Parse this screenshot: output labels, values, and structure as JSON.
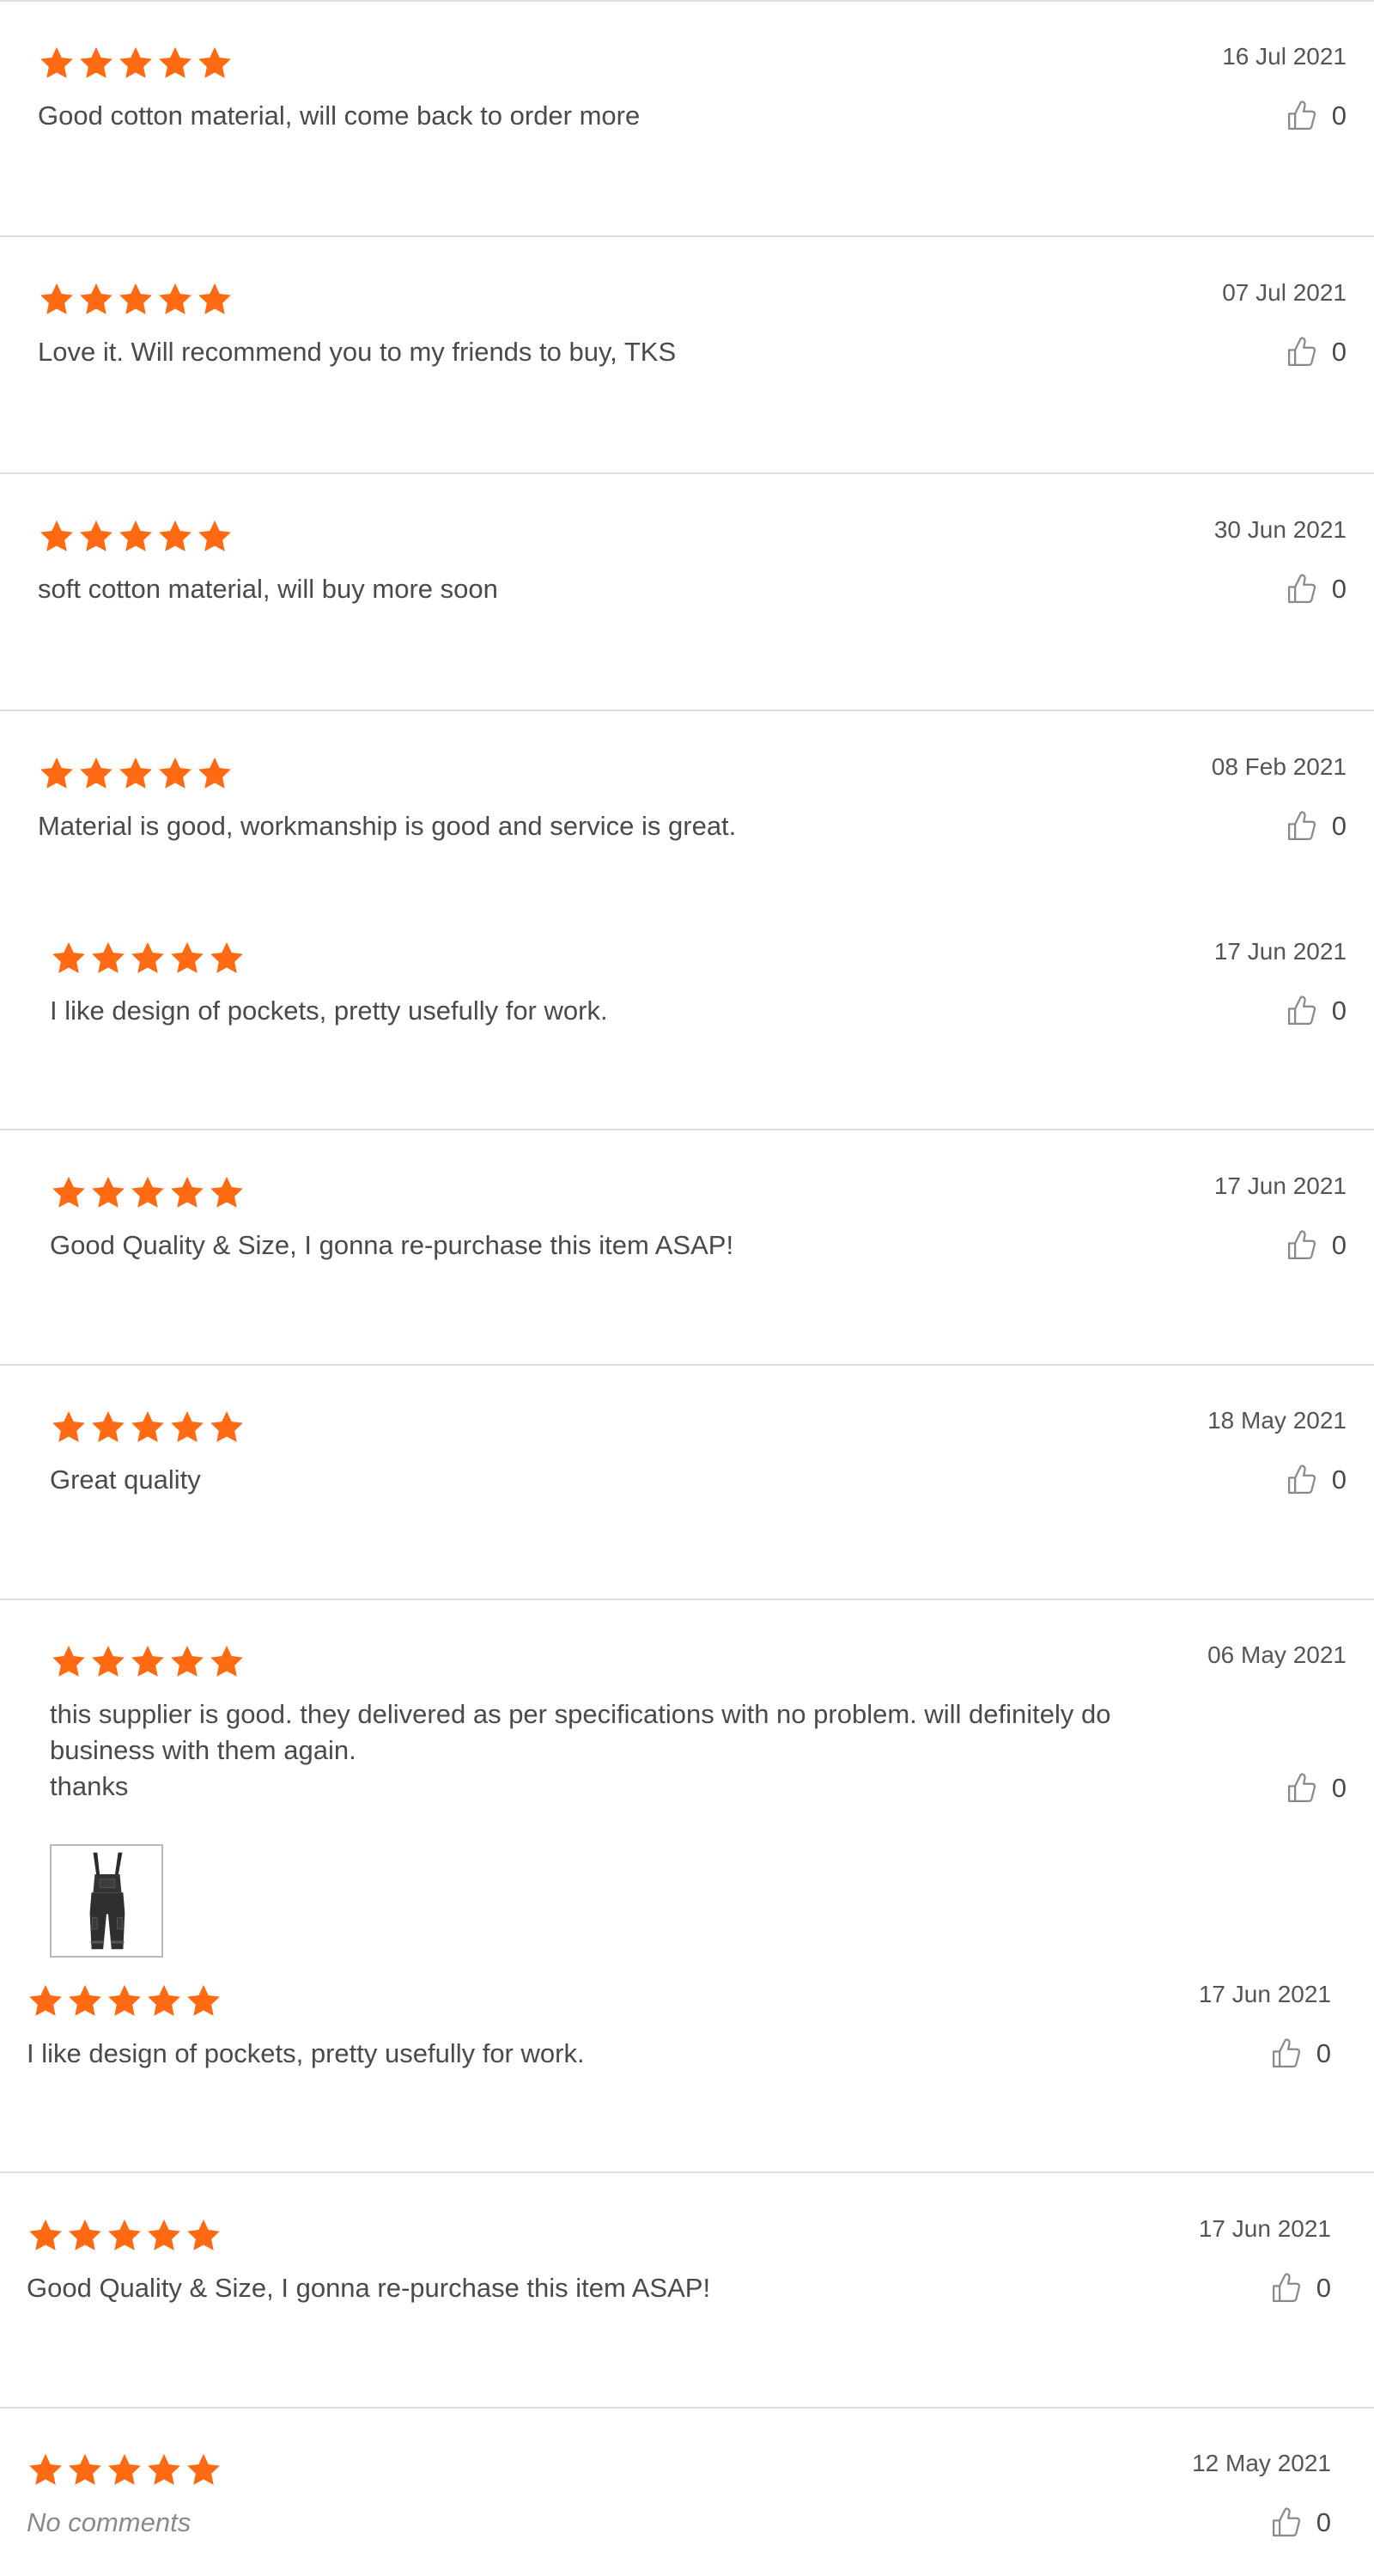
{
  "colors": {
    "star": "#FF6A13",
    "divider": "#DEDEDE",
    "text": "#4A4A4A",
    "date": "#555555"
  },
  "reviews": [
    {
      "rating": 5,
      "date": "16 Jul 2021",
      "comment": "Good cotton material, will come back to order more",
      "likes": "0"
    },
    {
      "rating": 5,
      "date": "07 Jul 2021",
      "comment": "Love it. Will recommend you to my friends to buy, TKS",
      "likes": "0"
    },
    {
      "rating": 5,
      "date": "30 Jun 2021",
      "comment": "soft cotton material, will buy more soon",
      "likes": "0"
    },
    {
      "rating": 5,
      "date": "08 Feb 2021",
      "comment": "Material is good, workmanship is good and service is great.",
      "likes": "0"
    },
    {
      "rating": 5,
      "date": "17 Jun 2021",
      "comment": "I like design of pockets, pretty usefully for work.",
      "likes": "0"
    },
    {
      "rating": 5,
      "date": "17 Jun 2021",
      "comment": "Good Quality & Size, I gonna re-purchase this item ASAP!",
      "likes": "0"
    },
    {
      "rating": 5,
      "date": "18 May 2021",
      "comment": "Great quality",
      "likes": "0"
    },
    {
      "rating": 5,
      "date": "06 May 2021",
      "comment": "this supplier is good. they delivered as per specifications with no problem. will definitely do business with them again.\nthanks",
      "likes": "0",
      "photo": "overalls-photo"
    },
    {
      "rating": 5,
      "date": "17 Jun 2021",
      "comment": "I like design of pockets, pretty usefully for work.",
      "likes": "0"
    },
    {
      "rating": 5,
      "date": "17 Jun 2021",
      "comment": "Good Quality & Size, I gonna re-purchase this item ASAP!",
      "likes": "0"
    },
    {
      "rating": 5,
      "date": "12 May 2021",
      "comment": "No comments",
      "likes": "0"
    }
  ]
}
